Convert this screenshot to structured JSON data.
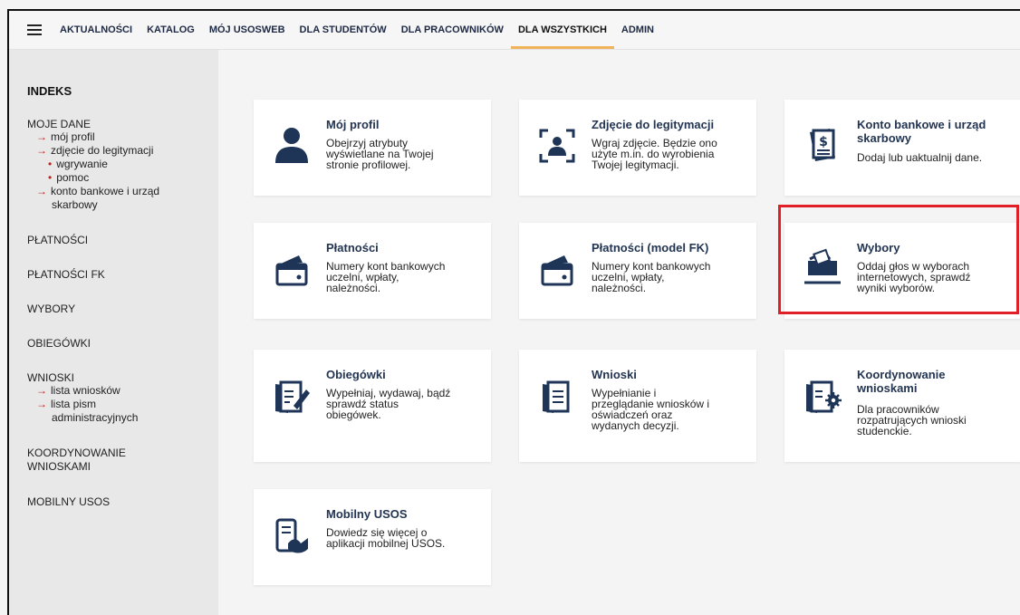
{
  "nav": {
    "items": [
      "AKTUALNOŚCI",
      "KATALOG",
      "MÓJ USOSWEB",
      "DLA STUDENTÓW",
      "DLA PRACOWNIKÓW",
      "DLA WSZYSTKICH",
      "ADMIN"
    ],
    "active": "DLA WSZYSTKICH",
    "accent_color": "#f0b35a"
  },
  "sidebar": {
    "title": "INDEKS",
    "moje_dane": {
      "label": "MOJE DANE",
      "items": [
        "mój profil",
        "zdjęcie do legitymacji",
        "konto bankowe i urząd"
      ],
      "konto_cont": "skarbowy",
      "subitems": [
        "wgrywanie",
        "pomoc"
      ]
    },
    "platnosci": "PŁATNOŚCI",
    "platnosci_fk": "PŁATNOŚCI FK",
    "wybory": "WYBORY",
    "obiegowki": "OBIEGÓWKI",
    "wnioski": {
      "label": "WNIOSKI",
      "items": [
        "lista wniosków",
        "lista pism"
      ],
      "pism_cont": "administracyjnych"
    },
    "koordynowanie": [
      "KOORDYNOWANIE",
      "WNIOSKAMI"
    ],
    "mobilny": "MOBILNY USOS"
  },
  "cards": {
    "profil": {
      "title": "Mój profil",
      "desc": [
        "Obejrzyj atrybuty",
        "wyświetlane na Twojej",
        "stronie profilowej."
      ],
      "icon": "user-icon"
    },
    "zdjecie": {
      "title": "Zdjęcie do legitymacji",
      "desc": [
        "Wgraj zdjęcie. Będzie ono",
        "użyte m.in. do wyrobienia",
        "Twojej legitymacji."
      ],
      "icon": "photo-frame-icon"
    },
    "konto": {
      "title": [
        "Konto bankowe i urząd",
        "skarbowy"
      ],
      "desc": [
        "Dodaj lub uaktualnij dane."
      ],
      "icon": "bank-document-icon"
    },
    "platnosci": {
      "title": "Płatności",
      "desc": [
        "Numery kont bankowych",
        "uczelni, wpłaty,",
        "należności."
      ],
      "icon": "wallet-icon"
    },
    "platnosci_fk": {
      "title": "Płatności (model FK)",
      "desc": [
        "Numery kont bankowych",
        "uczelni, wpłaty,",
        "należności."
      ],
      "icon": "wallet-icon"
    },
    "wybory": {
      "title": "Wybory",
      "desc": [
        "Oddaj głos w wyborach",
        "internetowych, sprawdź",
        "wyniki wyborów."
      ],
      "icon": "ballot-box-icon"
    },
    "obiegowki": {
      "title": "Obiegówki",
      "desc": [
        "Wypełniaj, wydawaj, bądź",
        "sprawdź status",
        "obiegówek."
      ],
      "icon": "edit-document-icon"
    },
    "wnioski": {
      "title": "Wnioski",
      "desc": [
        "Wypełnianie i",
        "przeglądanie wniosków i",
        "oświadczeń oraz",
        "wydanych decyzji."
      ],
      "icon": "document-list-icon"
    },
    "koordynowanie": {
      "title": [
        "Koordynowanie",
        "wnioskami"
      ],
      "desc": [
        "Dla pracowników",
        "rozpatrujących wnioski",
        "studenckie."
      ],
      "icon": "document-gear-icon"
    },
    "mobilny": {
      "title": "Mobilny USOS",
      "desc": [
        "Dowiedz się więcej o",
        "aplikacji mobilnej USOS."
      ],
      "icon": "mobile-phone-icon"
    }
  },
  "colors": {
    "icon": "#1e3557",
    "highlight": "#e01f26",
    "sidebar_bg": "#e8e8e8"
  }
}
